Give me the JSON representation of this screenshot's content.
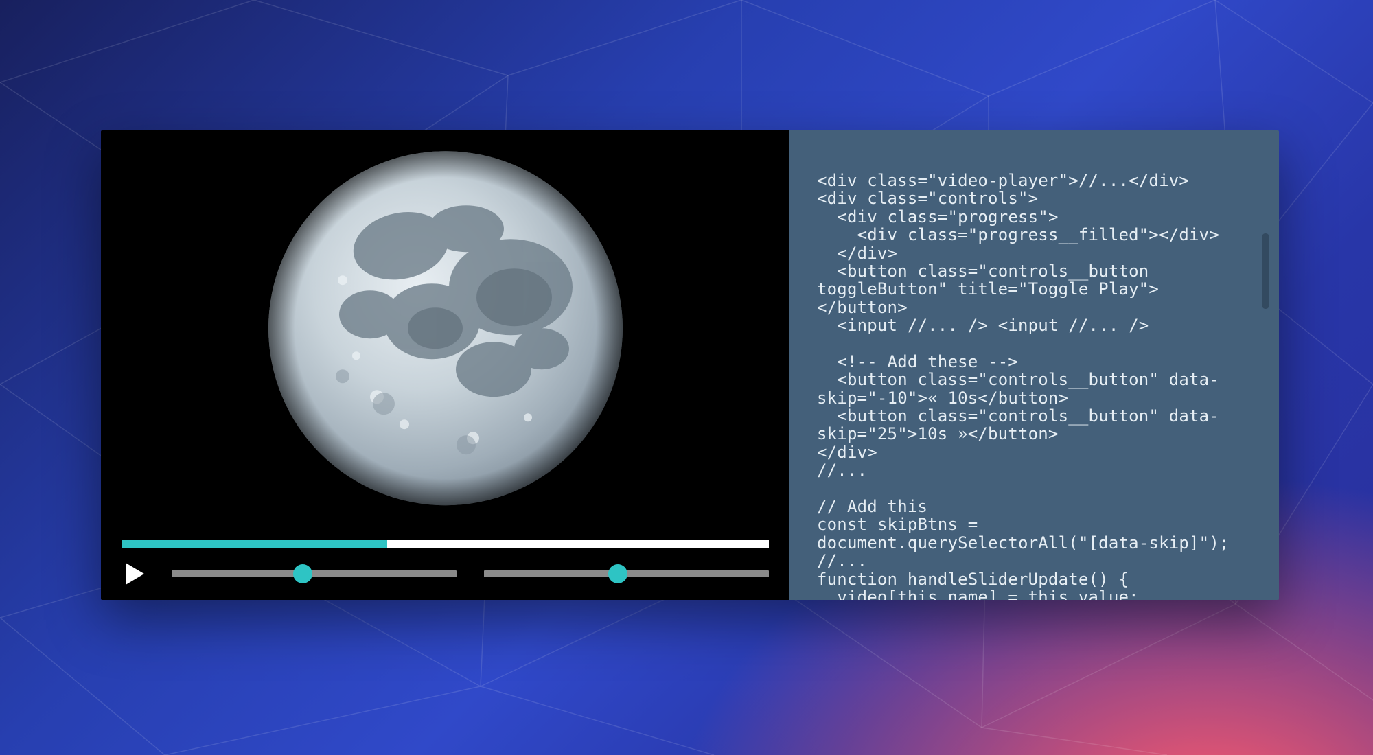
{
  "player": {
    "progress_percent": 41,
    "slider1_percent": 46,
    "slider2_percent": 47
  },
  "code": {
    "lines": [
      "<div class=\"video-player\">//...</div>",
      "<div class=\"controls\">",
      "  <div class=\"progress\">",
      "    <div class=\"progress__filled\"></div>",
      "  </div>",
      "  <button class=\"controls__button toggleButton\" title=\"Toggle Play\"> </button>",
      "  <input //... /> <input //... />",
      "",
      "  <!-- Add these -->",
      "  <button class=\"controls__button\" data-skip=\"-10\">« 10s</button>",
      "  <button class=\"controls__button\" data-skip=\"25\">10s »</button>",
      "</div>",
      "//...",
      "",
      "// Add this",
      "const skipBtns = document.querySelectorAll(\"[data-skip]\");",
      "//...",
      "function handleSliderUpdate() {",
      "  video[this.name] = this.value;",
      "}"
    ]
  }
}
